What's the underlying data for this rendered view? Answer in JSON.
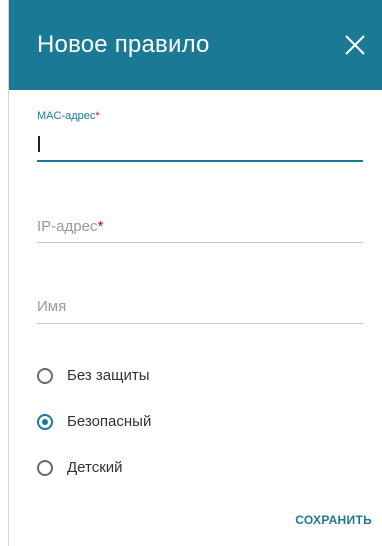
{
  "dialog": {
    "title": "Новое правило",
    "header_color": "#1a7a96",
    "accent_color": "#1a7a96",
    "required_marker": "*"
  },
  "fields": {
    "mac": {
      "label": "MAC-адрес",
      "value": ""
    },
    "ip": {
      "placeholder": "IP-адрес",
      "value": ""
    },
    "name": {
      "placeholder": "Имя",
      "value": ""
    }
  },
  "protection": {
    "options": [
      {
        "label": "Без защиты",
        "checked": false
      },
      {
        "label": "Безопасный",
        "checked": true
      },
      {
        "label": "Детский",
        "checked": false
      }
    ]
  },
  "actions": {
    "save_label": "СОХРАНИТЬ"
  },
  "icons": {
    "close": "close-icon"
  }
}
